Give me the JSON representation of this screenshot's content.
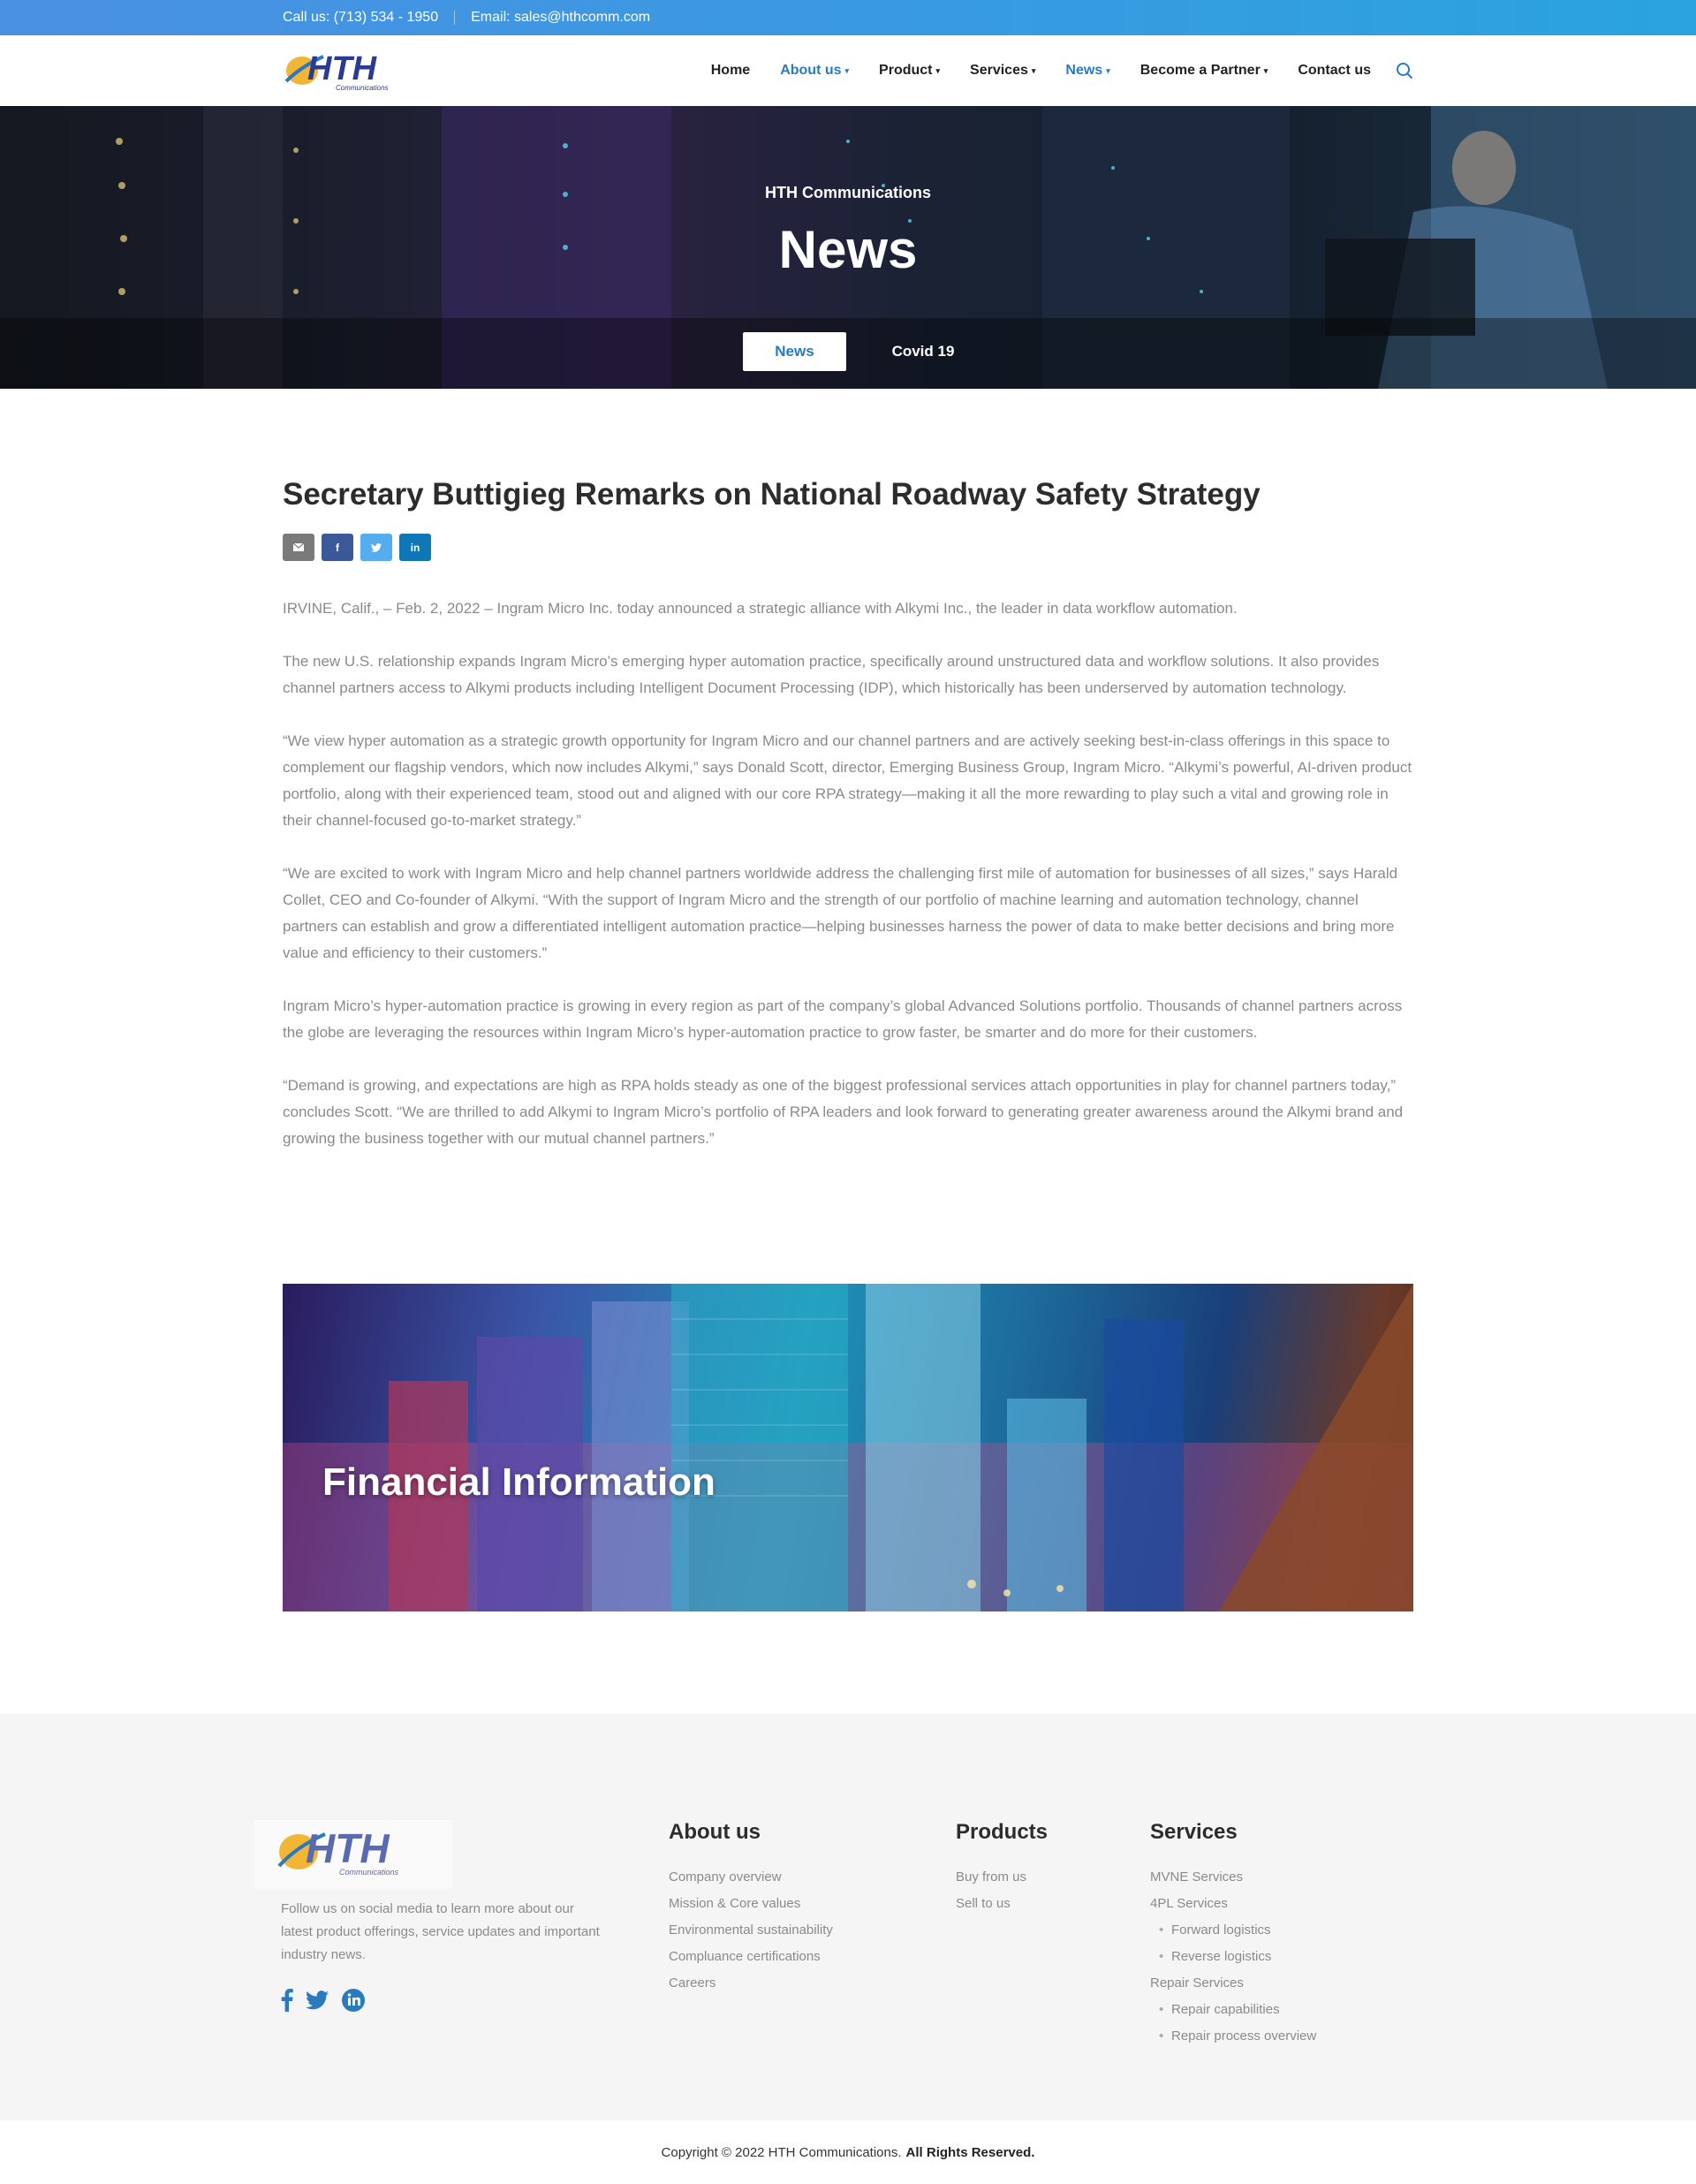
{
  "topbar": {
    "phone": "Call us: (713) 534 - 1950",
    "email": "Email: sales@hthcomm.com"
  },
  "brand": {
    "logo_text": "HTH",
    "logo_sub": "Communications",
    "accent_color": "#2a7ac0",
    "topbar_color": "#4a90e2"
  },
  "nav": {
    "items": [
      {
        "label": "Home",
        "active": false,
        "dropdown": false
      },
      {
        "label": "About us",
        "active": true,
        "dropdown": true
      },
      {
        "label": "Product",
        "active": false,
        "dropdown": true
      },
      {
        "label": "Services",
        "active": false,
        "dropdown": true
      },
      {
        "label": "News",
        "active": true,
        "dropdown": true
      },
      {
        "label": "Become a Partner",
        "active": false,
        "dropdown": true
      },
      {
        "label": "Contact us",
        "active": false,
        "dropdown": false
      }
    ],
    "search_icon": "search-icon"
  },
  "hero": {
    "subtitle": "HTH Communications",
    "title": "News",
    "tabs": [
      {
        "label": "News",
        "active": true
      },
      {
        "label": "Covid 19",
        "active": false
      }
    ]
  },
  "article": {
    "title": "Secretary Buttigieg Remarks on National Roadway Safety Strategy",
    "share": {
      "email_icon": "envelope-icon",
      "facebook": "f",
      "twitter_icon": "twitter-icon",
      "linkedin": "in"
    },
    "paragraphs": [
      "IRVINE, Calif., – Feb. 2, 2022 – Ingram Micro Inc. today announced a strategic alliance with Alkymi Inc., the leader in data workflow automation.",
      "The new U.S. relationship expands Ingram Micro’s emerging hyper automation practice, specifically around unstructured data and workflow solutions. It also provides channel partners access to Alkymi products including Intelligent Document Processing (IDP), which historically has been underserved by automation technology.",
      "“We view hyper automation as a strategic growth opportunity for Ingram Micro and our channel partners and are actively seeking best-in-class offerings in this space to complement our flagship vendors, which now includes Alkymi,” says Donald Scott, director, Emerging Business Group, Ingram Micro. “Alkymi’s powerful, AI-driven product portfolio, along with their experienced team, stood out and aligned with our core RPA strategy—making it all the more rewarding to play such a vital and growing role in their channel-focused go-to-market strategy.”",
      "“We are excited to work with Ingram Micro and help channel partners worldwide address the challenging first mile of automation for businesses of all sizes,” says Harald Collet, CEO and Co-founder of Alkymi. “With the support of Ingram Micro and the strength of our portfolio of machine learning and automation technology, channel partners can establish and grow a differentiated intelligent automation practice—helping businesses harness the power of data to make better decisions and bring more value and efficiency to their customers.”",
      "Ingram Micro’s hyper-automation practice is growing in every region as part of the company’s global Advanced Solutions portfolio. Thousands of channel partners across the globe are leveraging the resources within Ingram Micro’s hyper-automation practice to grow faster, be smarter and do more for their customers.",
      "“Demand is growing, and expectations are high as RPA holds steady as one of the biggest professional services attach opportunities in play for channel partners today,” concludes Scott. “We are thrilled to add Alkymi to Ingram Micro’s portfolio of RPA leaders and look forward to generating greater awareness around the Alkymi brand and growing the business together with our mutual channel partners.”"
    ]
  },
  "banner": {
    "title": "Financial Information"
  },
  "footer": {
    "description": "Follow us on social media to learn more about our latest product offerings, service updates and important industry news.",
    "social": [
      "facebook-icon",
      "twitter-icon",
      "linkedin-icon"
    ],
    "about": {
      "heading": "About us",
      "links": [
        "Company overview",
        "Mission & Core values",
        "Environmental sustainability",
        "Compluance certifications",
        "Careers"
      ]
    },
    "products": {
      "heading": "Products",
      "links": [
        "Buy from us",
        "Sell to us"
      ]
    },
    "services": {
      "heading": "Services",
      "links": [
        {
          "label": "MVNE Services",
          "sub": false
        },
        {
          "label": "4PL Services",
          "sub": false
        },
        {
          "label": "Forward logistics",
          "sub": true
        },
        {
          "label": "Reverse logistics",
          "sub": true
        },
        {
          "label": "Repair Services",
          "sub": false
        },
        {
          "label": "Repair capabilities",
          "sub": true
        },
        {
          "label": "Repair process overview",
          "sub": true
        }
      ]
    }
  },
  "copyright": {
    "text": "Copyright © 2022 HTH Communications.",
    "bold": "All Rights Reserved."
  }
}
